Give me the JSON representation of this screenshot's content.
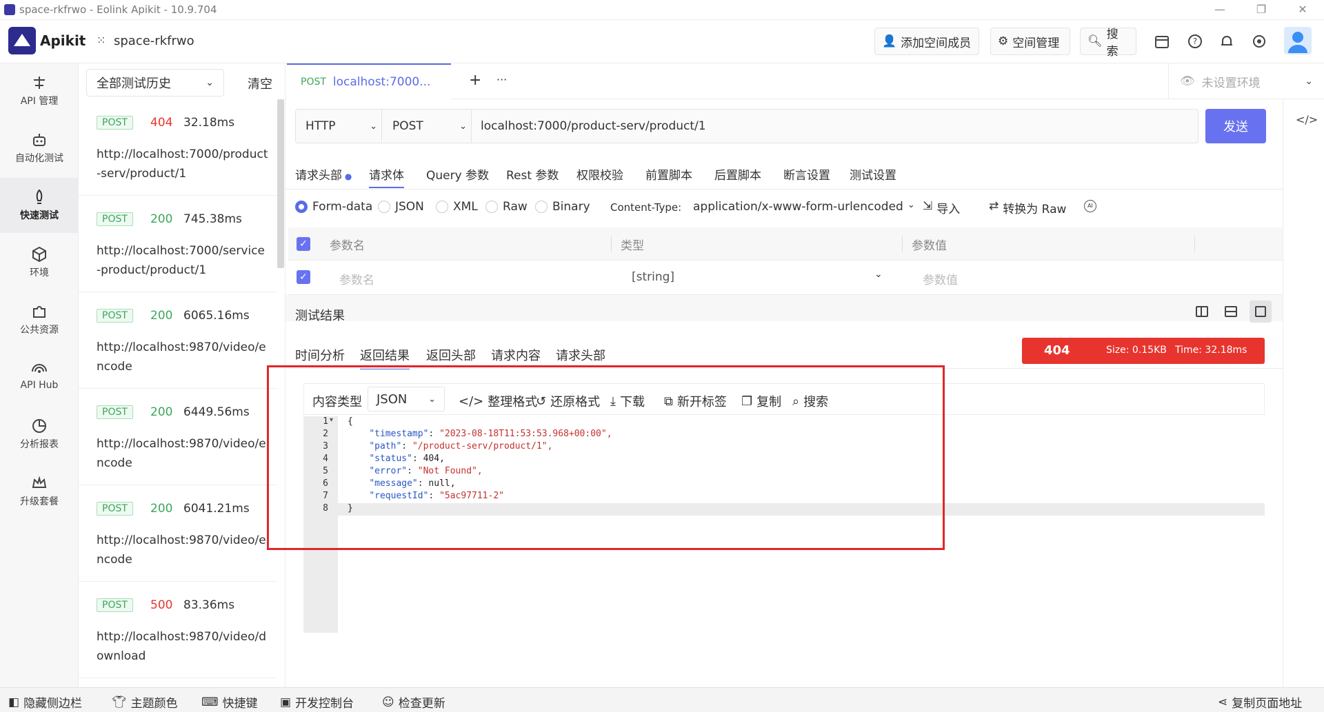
{
  "window": {
    "title": "space-rkfrwo - Eolink Apikit - 10.9.704"
  },
  "header": {
    "brand": "Apikit",
    "space": "space-rkfrwo",
    "add_member": "添加空间成员",
    "space_manage": "空间管理",
    "search": "搜索"
  },
  "nav": [
    {
      "label": "API 管理",
      "icon": "api-icon"
    },
    {
      "label": "自动化测试",
      "icon": "robot-icon"
    },
    {
      "label": "快速测试",
      "icon": "rocket-icon"
    },
    {
      "label": "环境",
      "icon": "cube-icon"
    },
    {
      "label": "公共资源",
      "icon": "puzzle-icon"
    },
    {
      "label": "API Hub",
      "icon": "broadcast-icon"
    },
    {
      "label": "分析报表",
      "icon": "pie-chart-icon"
    },
    {
      "label": "升级套餐",
      "icon": "crown-icon"
    }
  ],
  "history": {
    "filter": "全部测试历史",
    "clear": "清空",
    "items": [
      {
        "method": "POST",
        "code": "404",
        "time": "32.18ms",
        "url": "http://localhost:7000/product-serv/product/1"
      },
      {
        "method": "POST",
        "code": "200",
        "time": "745.38ms",
        "url": "http://localhost:7000/service-product/product/1"
      },
      {
        "method": "POST",
        "code": "200",
        "time": "6065.16ms",
        "url": "http://localhost:9870/video/encode"
      },
      {
        "method": "POST",
        "code": "200",
        "time": "6449.56ms",
        "url": "http://localhost:9870/video/encode"
      },
      {
        "method": "POST",
        "code": "200",
        "time": "6041.21ms",
        "url": "http://localhost:9870/video/encode"
      },
      {
        "method": "POST",
        "code": "500",
        "time": "83.36ms",
        "url": "http://localhost:9870/video/download"
      }
    ]
  },
  "tab": {
    "method": "POST",
    "url": "localhost:7000...",
    "add": "+",
    "more": "···"
  },
  "environment": "未设置环境",
  "request": {
    "protocol": "HTTP",
    "method": "POST",
    "url": "localhost:7000/product-serv/product/1",
    "send": "发送",
    "tabs": [
      "请求头部",
      "请求体",
      "Query 参数",
      "Rest 参数",
      "权限校验",
      "前置脚本",
      "后置脚本",
      "断言设置",
      "测试设置"
    ],
    "body_types": [
      "Form-data",
      "JSON",
      "XML",
      "Raw",
      "Binary"
    ],
    "content_type_label": "Content-Type:",
    "content_type": "application/x-www-form-urlencoded",
    "import": "导入",
    "to_raw": "转换为 Raw",
    "table_headers": [
      "参数名",
      "类型",
      "参数值"
    ],
    "row": {
      "name_placeholder": "参数名",
      "type": "[string]",
      "value_placeholder": "参数值"
    }
  },
  "result": {
    "title": "测试结果",
    "tabs": [
      "时间分析",
      "返回结果",
      "返回头部",
      "请求内容",
      "请求头部"
    ],
    "status_code": "404",
    "size": "Size: 0.15KB",
    "time": "Time: 32.18ms",
    "content_type_label": "内容类型",
    "content_type": "JSON",
    "tools": [
      "整理格式",
      "还原格式",
      "下载",
      "新开标签",
      "复制",
      "搜索"
    ],
    "code_lines": [
      {
        "n": "1",
        "key": "",
        "val": "{"
      },
      {
        "n": "2",
        "key": "\"timestamp\"",
        "val": "\"2023-08-18T11:53:53.968+00:00\","
      },
      {
        "n": "3",
        "key": "\"path\"",
        "val": "\"/product-serv/product/1\","
      },
      {
        "n": "4",
        "key": "\"status\"",
        "val": "404,"
      },
      {
        "n": "5",
        "key": "\"error\"",
        "val": "\"Not Found\","
      },
      {
        "n": "6",
        "key": "\"message\"",
        "val": "null,"
      },
      {
        "n": "7",
        "key": "\"requestId\"",
        "val": "\"5ac97711-2\""
      },
      {
        "n": "8",
        "key": "",
        "val": "}"
      }
    ]
  },
  "statusbar": {
    "hide_sidebar": "隐藏侧边栏",
    "theme": "主题颜色",
    "shortcuts": "快捷键",
    "devtools": "开发控制台",
    "check_update": "检查更新",
    "copy_url": "复制页面地址"
  },
  "colors": {
    "accent": "#6872f0",
    "error": "#e8342e",
    "success": "#3da55c"
  }
}
